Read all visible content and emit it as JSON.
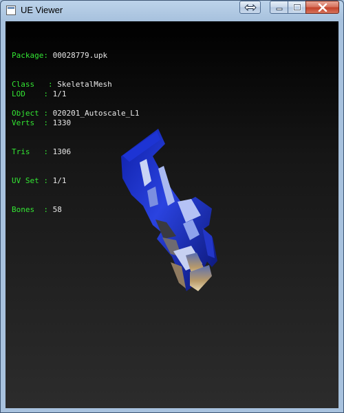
{
  "window": {
    "title": "UE Viewer",
    "icon": "app-icon",
    "buttons": {
      "restore_arrows": "double-arrow-icon",
      "minimize": "minimize-icon",
      "maximize": "maximize-icon",
      "close": "close-icon"
    }
  },
  "object_info": {
    "package_label": "Package",
    "package_value": "00028779.upk",
    "class_label": "Class",
    "class_value": "SkeletalMesh",
    "object_label": "Object",
    "object_value": "020201_Autoscale_L1"
  },
  "mesh_stats": {
    "lod_label": "LOD",
    "lod_value": "1/1",
    "verts_label": "Verts",
    "verts_value": "1330",
    "tris_label": "Tris",
    "tris_value": "1306",
    "uvset_label": "UV Set",
    "uvset_value": "1/1",
    "bones_label": "Bones",
    "bones_value": "58"
  },
  "colors": {
    "label_green": "#33e633",
    "value_white": "#e8e8e8",
    "mesh_blue": "#1a2fd0"
  }
}
